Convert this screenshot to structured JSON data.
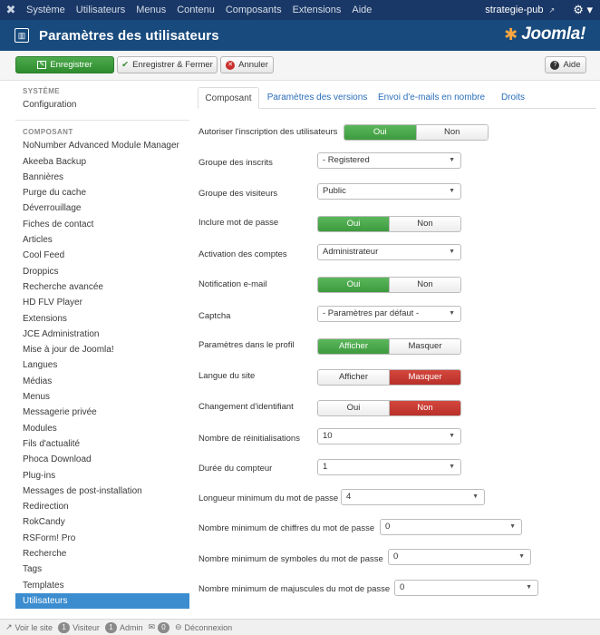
{
  "navbar": {
    "logo_icon": "joomla-icon",
    "menu": [
      "Système",
      "Utilisateurs",
      "Menus",
      "Contenu",
      "Composants",
      "Extensions",
      "Aide"
    ],
    "site_name": "strategie-pub",
    "external_icon": "external-link-icon",
    "gear_icon": "gear-icon"
  },
  "header": {
    "title": "Paramètres des utilisateurs",
    "icon": "users-icon",
    "brand": "Joomla!"
  },
  "toolbar": {
    "save_label": "Enregistrer",
    "save_close_label": "Enregistrer & Fermer",
    "cancel_label": "Annuler",
    "help_label": "Aide",
    "save_icon": "✎",
    "save_close_icon": "✔",
    "cancel_icon": "✕",
    "help_icon": "?"
  },
  "sidebar": {
    "system_heading": "SYSTÈME",
    "system_items": [
      "Configuration"
    ],
    "component_heading": "COMPOSANT",
    "component_items": [
      "NoNumber Advanced Module Manager",
      "Akeeba Backup",
      "Bannières",
      "Purge du cache",
      "Déverrouillage",
      "Fiches de contact",
      "Articles",
      "Cool Feed",
      "Droppics",
      "Recherche avancée",
      "HD FLV Player",
      "Extensions",
      "JCE Administration",
      "Mise à jour de Joomla!",
      "Langues",
      "Médias",
      "Menus",
      "Messagerie privée",
      "Modules",
      "Fils d'actualité",
      "Phoca Download",
      "Plug-ins",
      "Messages de post-installation",
      "Redirection",
      "RokCandy",
      "RSForm! Pro",
      "Recherche",
      "Tags",
      "Templates",
      "Utilisateurs"
    ],
    "active_item": "Utilisateurs"
  },
  "tabs": [
    "Composant",
    "Paramètres des versions",
    "Envoi d'e-mails en nombre",
    "Droits"
  ],
  "form": {
    "allow_registration": {
      "label": "Autoriser l'inscription des utilisateurs",
      "yes": "Oui",
      "no": "Non"
    },
    "new_user_group": {
      "label": "Groupe des inscrits",
      "value": "- Registered"
    },
    "guest_group": {
      "label": "Groupe des visiteurs",
      "value": "Public"
    },
    "send_password": {
      "label": "Inclure mot de passe",
      "yes": "Oui",
      "no": "Non"
    },
    "activation": {
      "label": "Activation des comptes",
      "value": "Administrateur"
    },
    "mail_notification": {
      "label": "Notification e-mail",
      "yes": "Oui",
      "no": "Non"
    },
    "captcha": {
      "label": "Captcha",
      "value": "- Paramètres par défaut -"
    },
    "frontend_params": {
      "label": "Paramètres dans le profil",
      "show": "Afficher",
      "hide": "Masquer"
    },
    "site_language": {
      "label": "Langue du site",
      "show": "Afficher",
      "hide": "Masquer"
    },
    "change_login": {
      "label": "Changement d'identifiant",
      "yes": "Oui",
      "no": "Non"
    },
    "reset_count": {
      "label": "Nombre de réinitialisations",
      "value": "10"
    },
    "reset_time": {
      "label": "Durée du compteur",
      "value": "1"
    },
    "min_length": {
      "label": "Longueur minimum du mot de passe",
      "value": "4"
    },
    "min_integers": {
      "label": "Nombre minimum de chiffres du mot de passe",
      "value": "0"
    },
    "min_symbols": {
      "label": "Nombre minimum de symboles du mot de passe",
      "value": "0"
    },
    "min_uppercase": {
      "label": "Nombre minimum de majuscules du mot de passe",
      "value": "0"
    }
  },
  "statusbar": {
    "view_site": "Voir le site",
    "visitors_count": "1",
    "visitors_label": "Visiteur",
    "admin_count": "1",
    "admin_label": "Admin",
    "messages_count": "0",
    "logout_label": "Déconnexion"
  },
  "colors": {
    "navbar": "#1a3867",
    "header": "#184a7d",
    "green": "#46a546",
    "red": "#bd362f",
    "active_sidebar": "#3c8dcf",
    "link": "#2a6ebb"
  }
}
